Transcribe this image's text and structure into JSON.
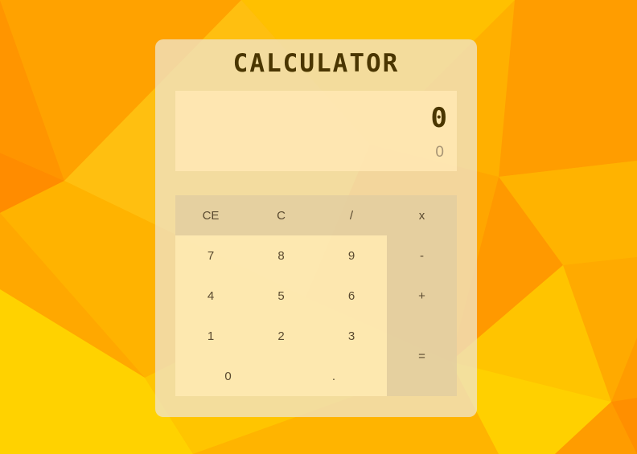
{
  "app": {
    "title": "CALCULATOR"
  },
  "display": {
    "main": "0",
    "sub": "0"
  },
  "keys": {
    "ce": "CE",
    "c": "C",
    "divide": "/",
    "multiply": "x",
    "seven": "7",
    "eight": "8",
    "nine": "9",
    "minus": "-",
    "four": "4",
    "five": "5",
    "six": "6",
    "plus": "+",
    "one": "1",
    "two": "2",
    "three": "3",
    "equals": "=",
    "zero": "0",
    "decimal": "."
  },
  "colors": {
    "background": "#ffb000",
    "accent_dark": "#4a3600",
    "panel": "#f0e4c8"
  }
}
